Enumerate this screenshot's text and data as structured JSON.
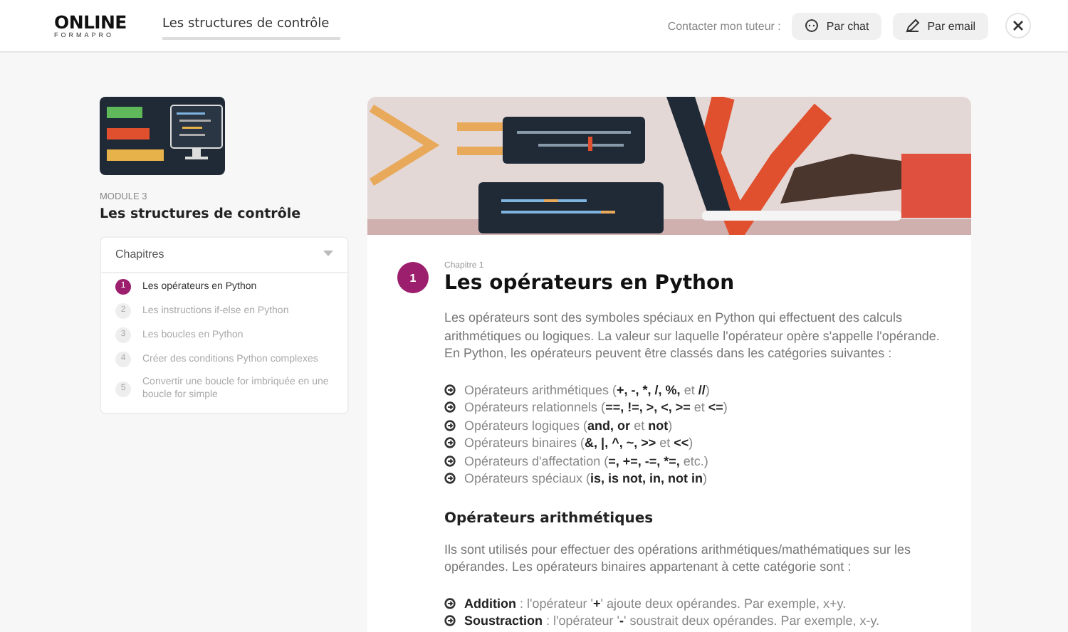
{
  "header": {
    "logo_text": "ONLINE",
    "logo_sub": "FORMAPRO",
    "course_title": "Les structures de contrôle",
    "contact_label": "Contacter mon tuteur :",
    "buttons": [
      {
        "kind": "chat",
        "label": "Par chat"
      },
      {
        "kind": "email",
        "label": "Par email"
      }
    ]
  },
  "sidebar": {
    "module_label": "MODULE 3",
    "module_title": "Les structures de contrôle",
    "chapters_title": "Chapitres",
    "expanded": true,
    "chapters": [
      {
        "number": "1",
        "title": "Les opérateurs en Python",
        "selected": true
      },
      {
        "number": "2",
        "title": "Les instructions if-else en Python",
        "selected": false
      },
      {
        "number": "3",
        "title": "Les boucles en Python",
        "selected": false
      },
      {
        "number": "4",
        "title": "Créer des conditions Python complexes",
        "selected": false
      },
      {
        "number": "5",
        "title": "Convertir une boucle for imbriquée en une boucle for simple",
        "selected": false
      }
    ]
  },
  "content": {
    "chapter_number": "1",
    "chapter_label": "Chapitre 1",
    "title": "Les opérateurs en Python",
    "intro": "Les opérateurs sont des symboles spéciaux en Python qui effectuent des calculs arithmétiques ou logiques. La valeur sur laquelle l'opérateur opère s'appelle l'opérande. En Python, les opérateurs peuvent être classés dans les catégories suivantes :",
    "categories": [
      [
        {
          "text": "Opérateurs arithmétiques (",
          "bold": false
        },
        {
          "text": "+, -, *, /, %,",
          "bold": true
        },
        {
          "text": " et ",
          "bold": false
        },
        {
          "text": "//",
          "bold": true
        },
        {
          "text": ")",
          "bold": false
        }
      ],
      [
        {
          "text": "Opérateurs relationnels (",
          "bold": false
        },
        {
          "text": "==, !=, >, <, >=",
          "bold": true
        },
        {
          "text": " et ",
          "bold": false
        },
        {
          "text": "<=",
          "bold": true
        },
        {
          "text": ")",
          "bold": false
        }
      ],
      [
        {
          "text": "Opérateurs logiques (",
          "bold": false
        },
        {
          "text": "and, or",
          "bold": true
        },
        {
          "text": " et ",
          "bold": false
        },
        {
          "text": "not",
          "bold": true
        },
        {
          "text": ")",
          "bold": false
        }
      ],
      [
        {
          "text": "Opérateurs binaires (",
          "bold": false
        },
        {
          "text": "&, |, ^, ~, >>",
          "bold": true
        },
        {
          "text": " et ",
          "bold": false
        },
        {
          "text": "<<",
          "bold": true
        },
        {
          "text": ")",
          "bold": false
        }
      ],
      [
        {
          "text": "Opérateurs d'affectation (",
          "bold": false
        },
        {
          "text": "=, +=, -=, *=,",
          "bold": true
        },
        {
          "text": " etc.)",
          "bold": false
        }
      ],
      [
        {
          "text": "Opérateurs spéciaux (",
          "bold": false
        },
        {
          "text": "is, is not, in, not in",
          "bold": true
        },
        {
          "text": ")",
          "bold": false
        }
      ]
    ],
    "section_title": "Opérateurs arithmétiques",
    "section_text": "Ils sont utilisés pour effectuer des opérations arithmétiques/mathématiques sur les opérandes. Les opérateurs binaires appartenant à cette catégorie sont :",
    "operators": [
      [
        {
          "text": "Addition",
          "bold": true
        },
        {
          "text": " : l'opérateur '",
          "bold": false
        },
        {
          "text": "+",
          "bold": true
        },
        {
          "text": "' ajoute deux opérandes. Par exemple, x+y.",
          "bold": false
        }
      ],
      [
        {
          "text": "Soustraction",
          "bold": true
        },
        {
          "text": " : l'opérateur '",
          "bold": false
        },
        {
          "text": "-",
          "bold": true
        },
        {
          "text": "' soustrait deux opérandes. Par exemple, x-y.",
          "bold": false
        }
      ]
    ]
  }
}
